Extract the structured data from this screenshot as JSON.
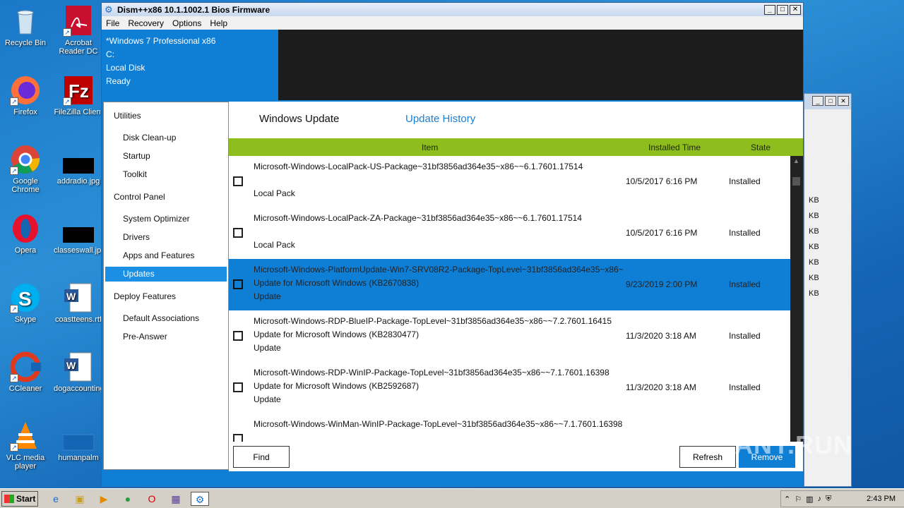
{
  "desktop": {
    "icons": [
      {
        "label": "Recycle Bin",
        "icon": "recycle-bin-icon"
      },
      {
        "label": "Acrobat Reader DC",
        "icon": "acrobat-icon"
      },
      {
        "label": "Firefox",
        "icon": "firefox-icon"
      },
      {
        "label": "FileZilla Client",
        "icon": "filezilla-icon"
      },
      {
        "label": "Google Chrome",
        "icon": "chrome-icon"
      },
      {
        "label": "addradio.jpg",
        "icon": "image-file-icon"
      },
      {
        "label": "Opera",
        "icon": "opera-icon"
      },
      {
        "label": "classeswall.jpg",
        "icon": "image-file-icon"
      },
      {
        "label": "Skype",
        "icon": "skype-icon"
      },
      {
        "label": "coastteens.rtf",
        "icon": "word-doc-icon"
      },
      {
        "label": "CCleaner",
        "icon": "ccleaner-icon"
      },
      {
        "label": "dogaccounting",
        "icon": "word-doc-icon"
      },
      {
        "label": "VLC media player",
        "icon": "vlc-icon"
      },
      {
        "label": "humanpalm",
        "icon": "image-file-icon"
      }
    ]
  },
  "bg_window": {
    "sizes": [
      "KB",
      "KB",
      "KB",
      "KB",
      "KB",
      "KB",
      "KB"
    ]
  },
  "window": {
    "title": "Dism++x86 10.1.1002.1 Bios Firmware",
    "menu": [
      "File",
      "Recovery",
      "Options",
      "Help"
    ],
    "info": {
      "os": "*Windows 7 Professional x86",
      "drive": "C:",
      "disk": "Local Disk",
      "status": "Ready"
    },
    "sidebar": {
      "utilities": "Utilities",
      "disk_cleanup": "Disk Clean-up",
      "startup": "Startup",
      "toolkit": "Toolkit",
      "control_panel": "Control Panel",
      "system_optimizer": "System Optimizer",
      "drivers": "Drivers",
      "apps_features": "Apps and Features",
      "updates": "Updates",
      "deploy_features": "Deploy Features",
      "default_assoc": "Default Associations",
      "pre_answer": "Pre-Answer"
    },
    "tabs": {
      "windows_update": "Windows Update",
      "update_history": "Update History"
    },
    "columns": {
      "item": "Item",
      "installed_time": "Installed Time",
      "state": "State"
    },
    "rows": [
      {
        "name": "Microsoft-Windows-LocalPack-US-Package~31bf3856ad364e35~x86~~6.1.7601.17514",
        "line2": "",
        "line3": "Local Pack",
        "time": "10/5/2017 6:16 PM",
        "state": "Installed"
      },
      {
        "name": "Microsoft-Windows-LocalPack-ZA-Package~31bf3856ad364e35~x86~~6.1.7601.17514",
        "line2": "",
        "line3": "Local Pack",
        "time": "10/5/2017 6:16 PM",
        "state": "Installed"
      },
      {
        "name": "Microsoft-Windows-PlatformUpdate-Win7-SRV08R2-Package-TopLevel~31bf3856ad364e35~x86~",
        "line2": "Update for Microsoft Windows (KB2670838)",
        "line3": "Update",
        "time": "9/23/2019 2:00 PM",
        "state": "Installed"
      },
      {
        "name": "Microsoft-Windows-RDP-BlueIP-Package-TopLevel~31bf3856ad364e35~x86~~7.2.7601.16415",
        "line2": "Update for Microsoft Windows (KB2830477)",
        "line3": "Update",
        "time": "11/3/2020 3:18 AM",
        "state": "Installed"
      },
      {
        "name": "Microsoft-Windows-RDP-WinIP-Package-TopLevel~31bf3856ad364e35~x86~~7.1.7601.16398",
        "line2": "Update for Microsoft Windows (KB2592687)",
        "line3": "Update",
        "time": "11/3/2020 3:18 AM",
        "state": "Installed"
      },
      {
        "name": "Microsoft-Windows-WinMan-WinIP-Package-TopLevel~31bf3856ad364e35~x86~~7.1.7601.16398",
        "line2": "",
        "line3": "",
        "time": "",
        "state": ""
      }
    ],
    "buttons": {
      "find": "Find",
      "refresh": "Refresh",
      "remove": "Remove"
    }
  },
  "taskbar": {
    "start": "Start",
    "clock": "2:43 PM"
  },
  "watermark": "ANY.RUN"
}
